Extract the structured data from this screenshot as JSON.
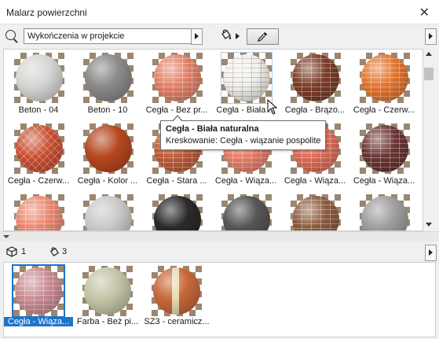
{
  "window": {
    "title": "Malarz powierzchni"
  },
  "search": {
    "filter_label": "Wykończenia w projekcie"
  },
  "gallery": {
    "rows": [
      [
        {
          "label": "Beton - 04",
          "color": "#d6d6d4",
          "style": "plain"
        },
        {
          "label": "Beton - 10",
          "color": "#8a8a8a",
          "style": "plain"
        },
        {
          "label": "Cegła - Bez pr...",
          "color": "#e38068",
          "style": "brick"
        },
        {
          "label": "Cegła - Biała ...",
          "color": "#f3f1ec",
          "style": "brick-white",
          "selected": true
        },
        {
          "label": "Cegła - Brązo...",
          "color": "#7c3d28",
          "style": "brick"
        },
        {
          "label": "Cegła - Czerw...",
          "color": "#e2752e",
          "style": "brick"
        }
      ],
      [
        {
          "label": "Cegła - Czerw...",
          "color": "#c94d30",
          "style": "herring"
        },
        {
          "label": "Cegła - Kolor ...",
          "color": "#b6471f",
          "style": "plain"
        },
        {
          "label": "Cegła - Stara ...",
          "color": "#bf5c3a",
          "style": "brick"
        },
        {
          "label": "Cegła - Wiąza...",
          "color": "#e77f6a",
          "style": "brick"
        },
        {
          "label": "Cegła - Wiąza...",
          "color": "#df6c58",
          "style": "brick"
        },
        {
          "label": "Cegła - Wiąza...",
          "color": "#6a3534",
          "style": "brick"
        }
      ],
      [
        {
          "label": "",
          "color": "#e98870",
          "style": "brick"
        },
        {
          "label": "",
          "color": "#c9c9c9",
          "style": "plain"
        },
        {
          "label": "",
          "color": "#2a2a2a",
          "style": "plain"
        },
        {
          "label": "",
          "color": "#555555",
          "style": "plain"
        },
        {
          "label": "",
          "color": "#8b5a3d",
          "style": "brick"
        },
        {
          "label": "",
          "color": "#9e9e9e",
          "style": "plain"
        }
      ]
    ]
  },
  "tooltip": {
    "title": "Cegła - Biała naturalna",
    "detail": "Kreskowanie: Cegła - wiązanie pospolite"
  },
  "bottom": {
    "element_count": "1",
    "surface_count": "3"
  },
  "used_materials": [
    {
      "label": "Cegła - Wiąza...",
      "color": "#c98b93",
      "style": "brick",
      "selected": true
    },
    {
      "label": "Farba - Beż pi...",
      "color": "#c5c4a8",
      "style": "plain"
    },
    {
      "label": "SZ3 - ceramicz...",
      "color": "#c7683a",
      "style": "split"
    }
  ],
  "colors": {
    "accent": "#1f73c9"
  }
}
